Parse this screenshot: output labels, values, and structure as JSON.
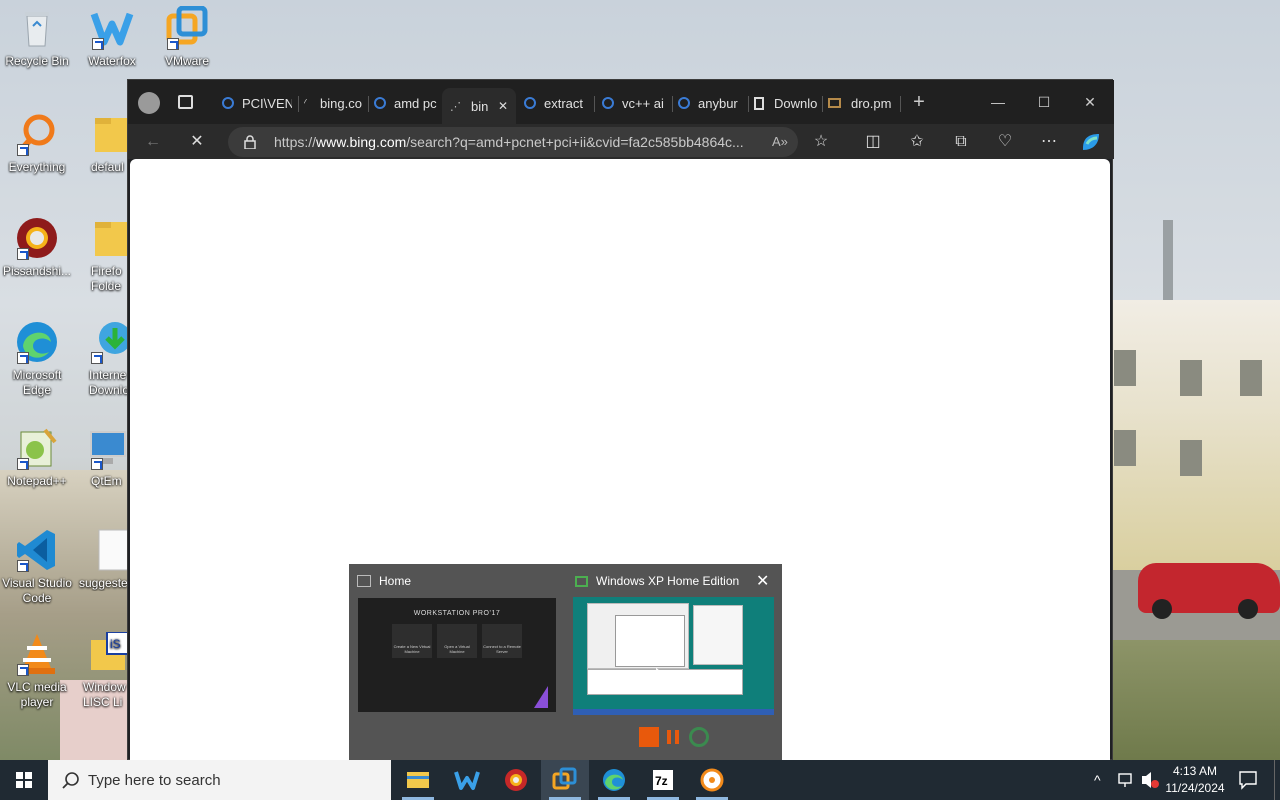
{
  "desktop": {
    "icons": [
      {
        "label": "Recycle Bin",
        "icon": "recycle-bin-icon"
      },
      {
        "label": "Waterfox",
        "icon": "waterfox-icon"
      },
      {
        "label": "VMware",
        "icon": "vmware-icon"
      },
      {
        "label": "Everything",
        "icon": "everything-search-icon"
      },
      {
        "label": "defaul",
        "icon": "folder-icon"
      },
      {
        "label": "Pissandshi...",
        "icon": "chrome-icon"
      },
      {
        "label": "Firefo Folde",
        "icon": "folder-icon"
      },
      {
        "label": "Microsoft Edge",
        "icon": "edge-icon"
      },
      {
        "label": "Interne Downlo",
        "icon": "internet-download-manager-icon"
      },
      {
        "label": "Notepad++",
        "icon": "notepadplusplus-icon"
      },
      {
        "label": "QtEm",
        "icon": "monitor-icon"
      },
      {
        "label": "Visual Studio Code",
        "icon": "vscode-icon"
      },
      {
        "label": "suggeste",
        "icon": "document-icon"
      },
      {
        "label": "VLC media player",
        "icon": "vlc-icon"
      },
      {
        "label": "Window LISC Li",
        "icon": "iso-file-icon"
      }
    ]
  },
  "browser": {
    "tabs": [
      {
        "label": "PCI\\VEN"
      },
      {
        "label": "bing.co"
      },
      {
        "label": "amd pc"
      },
      {
        "label": "bin"
      },
      {
        "label": "extract"
      },
      {
        "label": "vc++ ai"
      },
      {
        "label": "anybur"
      },
      {
        "label": "Downlo"
      },
      {
        "label": "dro.pm"
      }
    ],
    "address": {
      "prefix": "https://",
      "domain": "www.bing.com",
      "path": "/search?q=amd+pcnet+pci+ii&cvid=fa2c585bb4864c..."
    },
    "window_controls": {
      "minimize": "—",
      "maximize": "☐",
      "close": "✕"
    },
    "new_tab": "+"
  },
  "thumbnail_popup": {
    "home_title": "Home",
    "vm_title": "Windows XP Home Edition",
    "home_thumb_text": "WORKSTATION PRO’17",
    "home_thumb_buttons": [
      "Create a New Virtual Machine",
      "Open a Virtual Machine",
      "Connect to a Remote Server"
    ],
    "close": "✕"
  },
  "taskbar": {
    "search_placeholder": "Type here to search",
    "apps": [
      "file-explorer-icon",
      "waterfox-icon",
      "chrome-icon",
      "vmware-icon",
      "edge-icon",
      "7zip-icon",
      "media-icon"
    ],
    "clock_time": "4:13 AM",
    "clock_date": "11/24/2024"
  },
  "colors": {
    "accent": "#3a7bd5",
    "taskbar": "#202a33",
    "browser_dark": "#202020"
  }
}
